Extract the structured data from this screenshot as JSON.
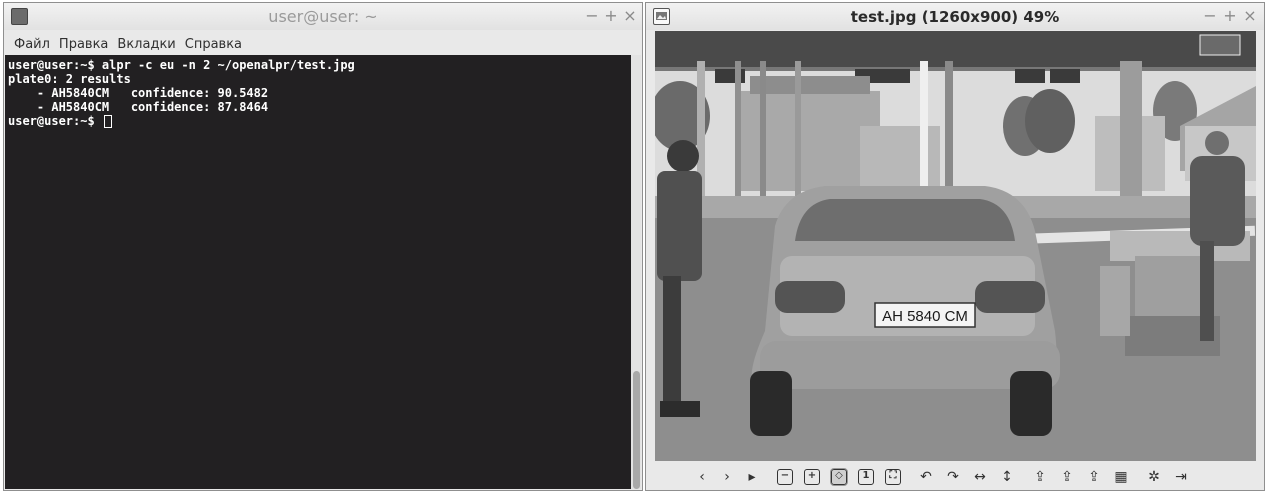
{
  "terminal": {
    "title": "user@user: ~",
    "menu": [
      "Файл",
      "Правка",
      "Вкладки",
      "Справка"
    ],
    "lines": [
      "user@user:~$ alpr -c eu -n 2 ~/openalpr/test.jpg",
      "plate0: 2 results",
      "    - AH5840CM   confidence: 90.5482",
      "    - AH5840CM   confidence: 87.8464",
      "user@user:~$ "
    ],
    "controls": {
      "minimize": "−",
      "maximize": "+",
      "close": "×"
    }
  },
  "viewer": {
    "title": "test.jpg (1260x900) 49%",
    "controls": {
      "minimize": "−",
      "maximize": "+",
      "close": "×"
    },
    "image": {
      "plate_text": "AH 5840 CM"
    },
    "toolbar": [
      {
        "name": "prev-icon",
        "glyph": "‹"
      },
      {
        "name": "next-icon",
        "glyph": "›"
      },
      {
        "name": "play-icon",
        "glyph": "▸"
      },
      {
        "name": "zoom-out-icon",
        "glyph": "−"
      },
      {
        "name": "zoom-in-icon",
        "glyph": "+"
      },
      {
        "name": "zoom-fit-icon",
        "glyph": "◇"
      },
      {
        "name": "zoom-original-icon",
        "glyph": "1"
      },
      {
        "name": "fullscreen-icon",
        "glyph": "⛶"
      },
      {
        "name": "rotate-left-icon",
        "glyph": "↶"
      },
      {
        "name": "rotate-right-icon",
        "glyph": "↷"
      },
      {
        "name": "flip-horizontal-icon",
        "glyph": "↔"
      },
      {
        "name": "flip-vertical-icon",
        "glyph": "↕"
      },
      {
        "name": "open-file-icon",
        "glyph": "⇪"
      },
      {
        "name": "save-as-icon",
        "glyph": "⇪"
      },
      {
        "name": "save-icon",
        "glyph": "⇪"
      },
      {
        "name": "save-disk-icon",
        "glyph": "▦"
      },
      {
        "name": "settings-icon",
        "glyph": "✲"
      },
      {
        "name": "exit-icon",
        "glyph": "⇥"
      }
    ]
  }
}
